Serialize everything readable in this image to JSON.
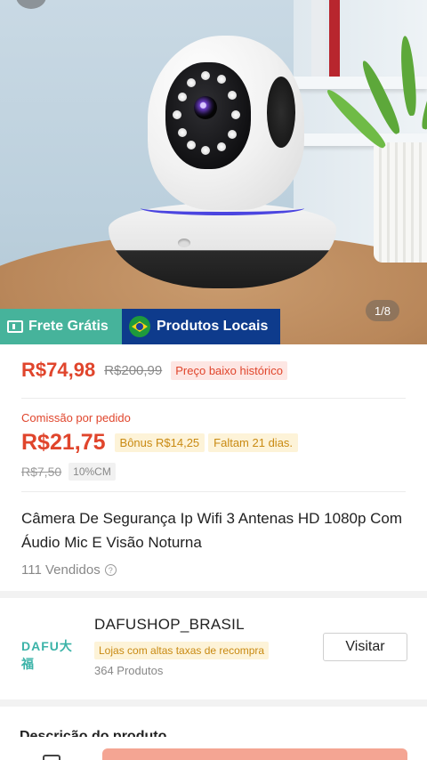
{
  "gallery": {
    "pager": "1/8",
    "badges": {
      "frete": "Frete Grátis",
      "locais": "Produtos Locais"
    },
    "colors": {
      "frete_bg": "#46b39b",
      "locais_bg": "#0e3b8c"
    }
  },
  "price": {
    "current": "R$74,98",
    "original": "R$200,99",
    "tag": "Preço baixo histórico"
  },
  "commission": {
    "label": "Comissão por pedido",
    "value": "R$21,75",
    "bonus": "Bônus R$14,25",
    "remaining": "Faltam 21 dias.",
    "old_value": "R$7,50",
    "rate": "10%CM"
  },
  "product": {
    "title": "Câmera De Segurança Ip Wifi 3 Antenas HD 1080p Com Áudio Mic E Visão Noturna",
    "sold": "111 Vendidos",
    "help_glyph": "?"
  },
  "shop": {
    "logo_text": "DAFU大福",
    "name": "DAFUSHOP_BRASIL",
    "tag": "Lojas com altas taxas de recompra",
    "products": "364 Produtos",
    "visit_label": "Visitar"
  },
  "next_section": {
    "heading": "Descrição do produto"
  },
  "accent_color": "#e0452c"
}
